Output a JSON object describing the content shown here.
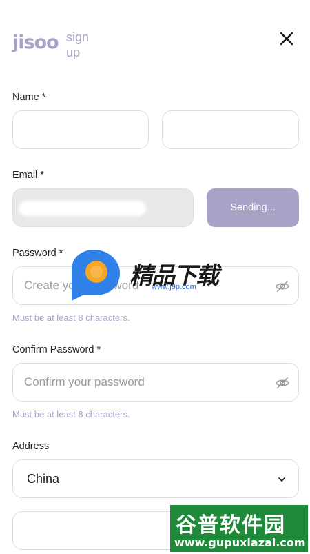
{
  "header": {
    "logo": "jisoo",
    "subtitle_line1": "sign",
    "subtitle_line2": "up"
  },
  "form": {
    "name": {
      "label": "Name *",
      "first_value": "",
      "last_value": ""
    },
    "email": {
      "label": "Email *",
      "value": "",
      "send_button": "Sending..."
    },
    "password": {
      "label": "Password *",
      "placeholder": "Create your password",
      "hint": "Must be at least 8 characters."
    },
    "confirm_password": {
      "label": "Confirm Password *",
      "placeholder": "Confirm your password",
      "hint": "Must be at least 8 characters."
    },
    "address": {
      "label": "Address",
      "country": "China",
      "detail_value": ""
    }
  },
  "watermarks": {
    "center_text": "精品下载",
    "center_url": "www.j9p.com",
    "corner_text": "谷普软件园",
    "corner_url": "www.gupuxiazai.com"
  },
  "colors": {
    "accent": "#a7a3c6",
    "border": "#dcdcdc",
    "disabled_bg": "#e9e9e9"
  }
}
